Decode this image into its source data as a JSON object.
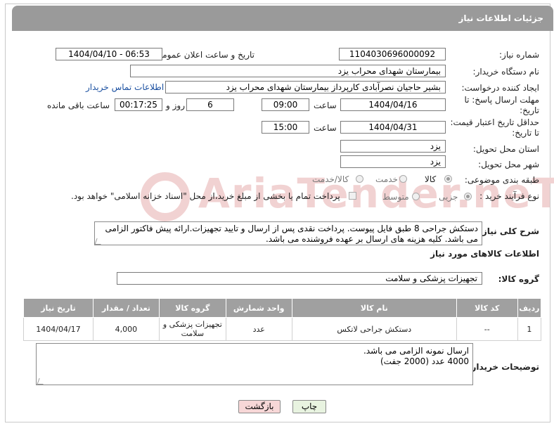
{
  "header": {
    "title": "جزئیات اطلاعات نیاز"
  },
  "labels": {
    "need_number": "شماره نیاز:",
    "announce_datetime": "تاریخ و ساعت اعلان عمومی:",
    "buyer_org": "نام دستگاه خریدار:",
    "requester": "ایجاد کننده درخواست:",
    "reply_deadline_line1": "مهلت ارسال پاسخ: تا",
    "reply_deadline_line2": "تاریخ:",
    "hour": "ساعت",
    "day_and": "روز و",
    "time_remaining": "ساعت باقی مانده",
    "min_price_line1": "حداقل تاریخ اعتبار قیمت:",
    "min_price_line2": "تا تاریخ:",
    "hour2": "ساعت",
    "delivery_province": "استان محل تحویل:",
    "delivery_city": "شهر محل تحویل:",
    "category": "طبقه بندی موضوعی:",
    "purchase_type": "نوع فرآیند خرید :",
    "description": "شرح کلی نیاز:",
    "items_info": "اطلاعات کالاهای مورد نیاز",
    "goods_group": "گروه کالا:",
    "buyer_notes": "توضیحات خریدار:"
  },
  "values": {
    "need_number": "1104030696000092",
    "announce_datetime": "1404/04/10 - 06:53",
    "buyer_org": "بیمارستان شهدای محراب یزد",
    "requester": "بشیر حاجیان نصرآبادی کارپرداز بیمارستان شهدای محراب یزد",
    "contact_link": "اطلاعات تماس خریدار",
    "reply_date": "1404/04/16",
    "reply_time": "09:00",
    "days": "6",
    "remaining": "00:17:25",
    "price_date": "1404/04/31",
    "price_time": "15:00",
    "province": "یزد",
    "city": "یزد",
    "description": "دستکش جراحی 8 طبق فایل پیوست. پرداخت نقدی پس از ارسال و تایید تجهیزات.ارائه پیش فاکتور الزامی می باشد. کلیه هزینه های ارسال بر عهده فروشنده می باشد.",
    "goods_group": "تجهیزات پزشکی و سلامت",
    "buyer_notes_line1": "ارسال نمونه الزامی می باشد.",
    "buyer_notes_line2": "4000 عدد (2000 جفت)"
  },
  "category_options": {
    "goods": "کالا",
    "service": "خدمت",
    "goods_service": "کالا/خدمت",
    "selected": "کالا"
  },
  "purchase_options": {
    "minor": "جزیی",
    "medium": "متوسط",
    "payment_note": "پرداخت تمام یا بخشی از مبلغ خرید،از محل \"اسناد خزانه اسلامی\" خواهد بود.",
    "selected": "جزیی"
  },
  "table": {
    "headers": [
      "ردیف",
      "کد کالا",
      "نام کالا",
      "واحد شمارش",
      "گروه کالا",
      "تعداد / مقدار",
      "تاریخ نیاز"
    ],
    "rows": [
      [
        "1",
        "--",
        "دستکش جراحی لاتکس",
        "عدد",
        "تجهیزات پزشکی و سلامت",
        "4,000",
        "1404/04/17"
      ]
    ]
  },
  "buttons": {
    "print": "چاپ",
    "back": "بازگشت"
  },
  "watermark": "AriaTender.neT",
  "colors": {
    "header_bg": "#9a9a9a",
    "link": "#1a4fa0",
    "back_button": "#f7d7d7",
    "print_button": "#e8f3e0",
    "watermark": "#f1d2d2"
  }
}
